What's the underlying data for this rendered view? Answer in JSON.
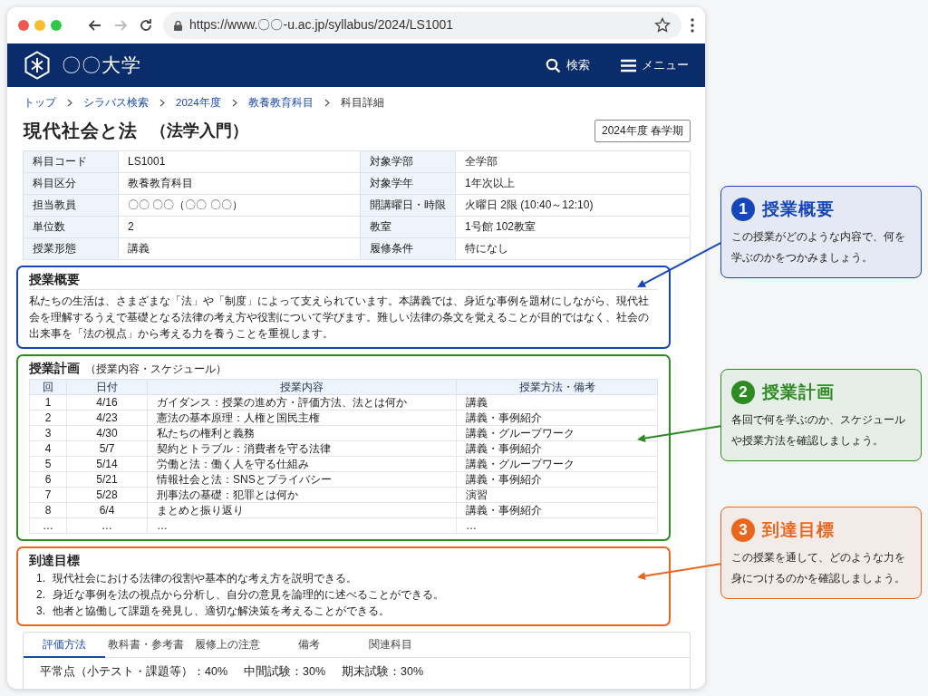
{
  "browser": {
    "url": "https://www.〇〇-u.ac.jp/syllabus/2024/LS1001",
    "forward_disabled": true
  },
  "header": {
    "site_name": "〇〇大学",
    "search_label": "検索",
    "menu_label": "メニュー"
  },
  "breadcrumbs": [
    {
      "label": "トップ",
      "kind": "link"
    },
    {
      "label": "シラバス検索",
      "kind": "link"
    },
    {
      "label": "2024年度",
      "kind": "link"
    },
    {
      "label": "教養教育科目",
      "kind": "link"
    },
    {
      "label": "科目詳細",
      "kind": "current"
    }
  ],
  "title": "現代社会と法",
  "title_sub": "（法学入門）",
  "term": "2024年度 春学期",
  "info_table": [
    {
      "label": "科目コード",
      "value": "LS1001",
      "label_2": "対象学部",
      "value_2": "全学部"
    },
    {
      "label": "科目区分",
      "value": "教養教育科目",
      "label_2": "対象学年",
      "value_2": "1年次以上"
    },
    {
      "label": "担当教員",
      "value": "〇〇 〇〇（〇〇 〇〇）",
      "label_2": "開講曜日・時限",
      "value_2": "火曜日 2限 (10:40～12:10)"
    },
    {
      "label": "単位数",
      "value": "2",
      "label_2": "教室",
      "value_2": "1号館 102教室"
    },
    {
      "label": "授業形態",
      "value": "講義",
      "label_2": "履修条件",
      "value_2": "特になし"
    }
  ],
  "overview": {
    "heading": "授業概要",
    "body": "私たちの生活は、さまざまな「法」や「制度」によって支えられています。本講義では、身近な事例を題材にしながら、現代社会を理解するうえで基礎となる法律の考え方や役割について学びます。難しい法律の条文を覚えることが目的ではなく、社会の出来事を「法の視点」から考える力を養うことを重視します。"
  },
  "plan": {
    "heading": "授業計画",
    "subheading": "（授業内容・スケジュール）",
    "columns": [
      "回",
      "日付",
      "授業内容",
      "授業方法・備考"
    ],
    "rows": [
      [
        "1",
        "4/16",
        "ガイダンス：授業の進め方・評価方法、法とは何か",
        "講義"
      ],
      [
        "2",
        "4/23",
        "憲法の基本原理：人権と国民主権",
        "講義・事例紹介"
      ],
      [
        "3",
        "4/30",
        "私たちの権利と義務",
        "講義・グループワーク"
      ],
      [
        "4",
        "5/7",
        "契約とトラブル：消費者を守る法律",
        "講義・事例紹介"
      ],
      [
        "5",
        "5/14",
        "労働と法：働く人を守る仕組み",
        "講義・グループワーク"
      ],
      [
        "6",
        "5/21",
        "情報社会と法：SNSとプライバシー",
        "講義・事例紹介"
      ],
      [
        "7",
        "5/28",
        "刑事法の基礎：犯罪とは何か",
        "演習"
      ],
      [
        "8",
        "6/4",
        "まとめと振り返り",
        "講義・事例紹介"
      ],
      [
        "…",
        "…",
        "…",
        "…"
      ]
    ]
  },
  "goals": {
    "heading": "到達目標",
    "items": [
      {
        "number": "1.",
        "text": "現代社会における法律の役割や基本的な考え方を説明できる。"
      },
      {
        "number": "2.",
        "text": "身近な事例を法の視点から分析し、自分の意見を論理的に述べることができる。"
      },
      {
        "number": "3.",
        "text": "他者と協働して課題を発見し、適切な解決策を考えることができる。"
      }
    ]
  },
  "tabs": [
    {
      "label": "評価方法",
      "selected": true
    },
    {
      "label": "教科書・参考書",
      "selected": false
    },
    {
      "label": "履修上の注意",
      "selected": false
    },
    {
      "label": "備考",
      "selected": false
    },
    {
      "label": "関連科目",
      "selected": false
    }
  ],
  "evaluation": [
    "平常点（小テスト・課題等）：40%",
    "中間試験：30%",
    "期末試験：30%"
  ],
  "callouts": [
    {
      "number": "1",
      "title": "授業概要",
      "text": "この授業がどのような内容で、何を学ぶのかをつかみましょう。",
      "color": "#1746b8"
    },
    {
      "number": "2",
      "title": "授業計画",
      "text": "各回で何を学ぶのか、スケジュールや授業方法を確認しましょう。",
      "color": "#2e8a22"
    },
    {
      "number": "3",
      "title": "到達目標",
      "text": "この授業を通して、どのような力を身につけるのかを確認しましょう。",
      "color": "#e8671e"
    }
  ]
}
